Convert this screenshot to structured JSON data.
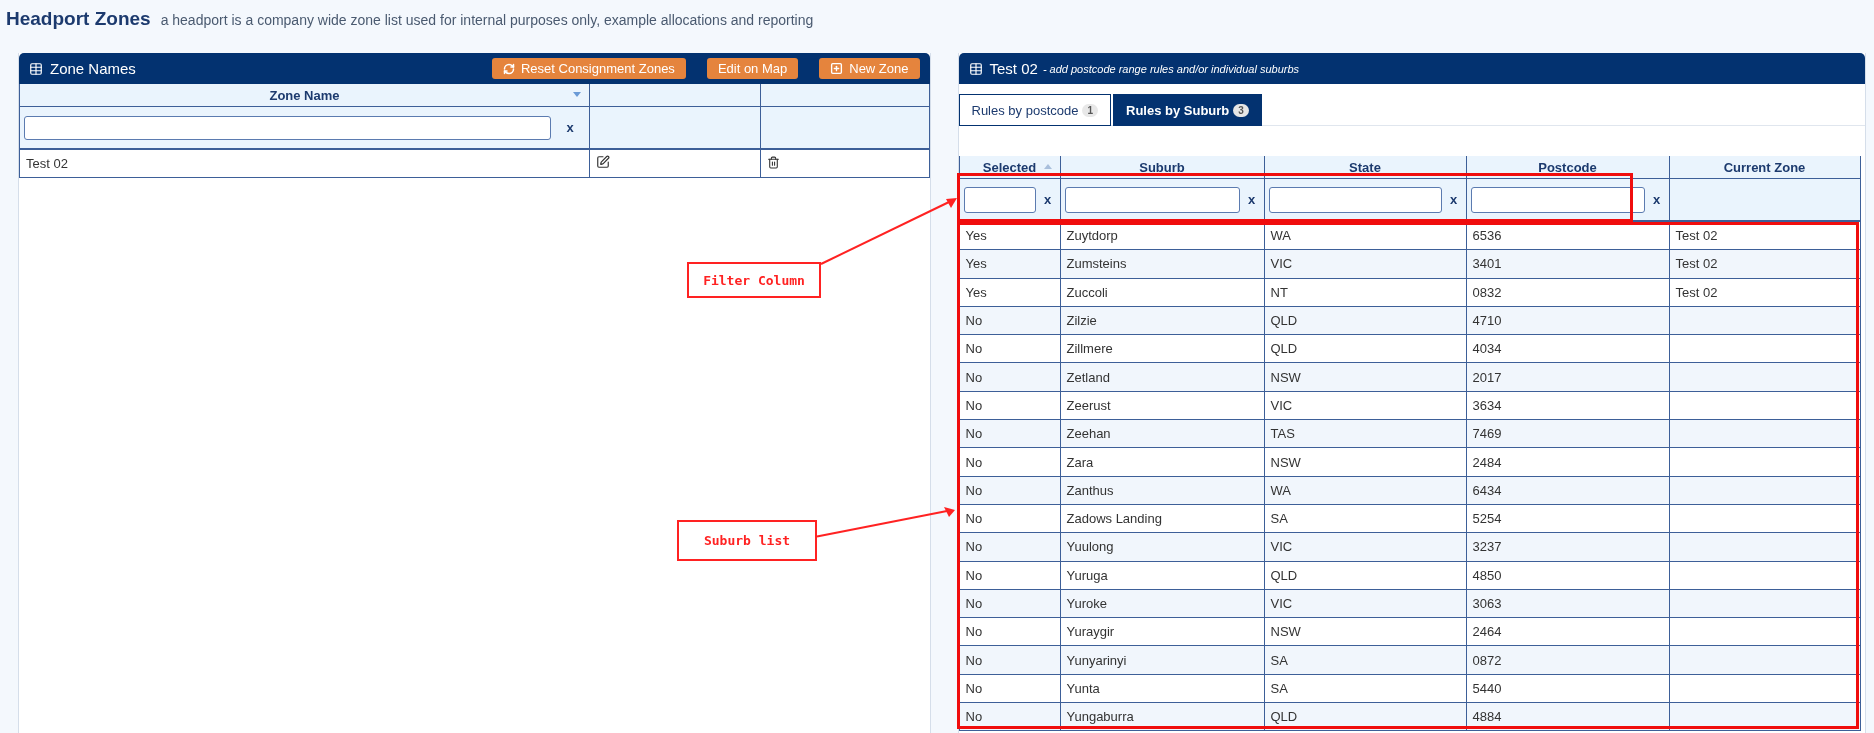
{
  "page": {
    "title": "Headport Zones",
    "subtitle": "a headport is a company wide zone list used for internal purposes only, example allocations and reporting"
  },
  "zones_panel": {
    "title": "Zone Names",
    "buttons": [
      {
        "label": "Reset Consignment Zones"
      },
      {
        "label": "Edit on Map"
      },
      {
        "label": "New Zone"
      }
    ],
    "columns": [
      {
        "label": "Zone Name",
        "sorted": true,
        "clear_label": "x"
      }
    ],
    "rows": [
      {
        "name": "Test 02"
      }
    ]
  },
  "rules_panel": {
    "title": "Test 02",
    "subtitle": "- add postcode range rules and/or individual suburbs",
    "tabs": [
      {
        "label": "Rules by postcode",
        "count": "1",
        "selected": false
      },
      {
        "label": "Rules by Suburb",
        "count": "3",
        "selected": true
      }
    ],
    "columns": [
      {
        "label": "Selected",
        "sorted": true,
        "clear_label": "x"
      },
      {
        "label": "Suburb",
        "sorted": false,
        "clear_label": "x"
      },
      {
        "label": "State",
        "sorted": false,
        "clear_label": "x"
      },
      {
        "label": "Postcode",
        "sorted": false,
        "clear_label": "x"
      },
      {
        "label": "Current Zone",
        "sorted": false
      }
    ],
    "rows": [
      {
        "selected": "Yes",
        "suburb": "Zuytdorp",
        "state": "WA",
        "postcode": "6536",
        "zone": "Test 02"
      },
      {
        "selected": "Yes",
        "suburb": "Zumsteins",
        "state": "VIC",
        "postcode": "3401",
        "zone": "Test 02"
      },
      {
        "selected": "Yes",
        "suburb": "Zuccoli",
        "state": "NT",
        "postcode": "0832",
        "zone": "Test 02"
      },
      {
        "selected": "No",
        "suburb": "Zilzie",
        "state": "QLD",
        "postcode": "4710"
      },
      {
        "selected": "No",
        "suburb": "Zillmere",
        "state": "QLD",
        "postcode": "4034"
      },
      {
        "selected": "No",
        "suburb": "Zetland",
        "state": "NSW",
        "postcode": "2017"
      },
      {
        "selected": "No",
        "suburb": "Zeerust",
        "state": "VIC",
        "postcode": "3634"
      },
      {
        "selected": "No",
        "suburb": "Zeehan",
        "state": "TAS",
        "postcode": "7469"
      },
      {
        "selected": "No",
        "suburb": "Zara",
        "state": "NSW",
        "postcode": "2484"
      },
      {
        "selected": "No",
        "suburb": "Zanthus",
        "state": "WA",
        "postcode": "6434"
      },
      {
        "selected": "No",
        "suburb": "Zadows Landing",
        "state": "SA",
        "postcode": "5254"
      },
      {
        "selected": "No",
        "suburb": "Yuulong",
        "state": "VIC",
        "postcode": "3237"
      },
      {
        "selected": "No",
        "suburb": "Yuruga",
        "state": "QLD",
        "postcode": "4850"
      },
      {
        "selected": "No",
        "suburb": "Yuroke",
        "state": "VIC",
        "postcode": "3063"
      },
      {
        "selected": "No",
        "suburb": "Yuraygir",
        "state": "NSW",
        "postcode": "2464"
      },
      {
        "selected": "No",
        "suburb": "Yunyarinyi",
        "state": "SA",
        "postcode": "0872"
      },
      {
        "selected": "No",
        "suburb": "Yunta",
        "state": "SA",
        "postcode": "5440"
      },
      {
        "selected": "No",
        "suburb": "Yungaburra",
        "state": "QLD",
        "postcode": "4884"
      }
    ]
  },
  "annotations": [
    {
      "label": "Filter Column"
    },
    {
      "label": "Suburb list"
    }
  ]
}
